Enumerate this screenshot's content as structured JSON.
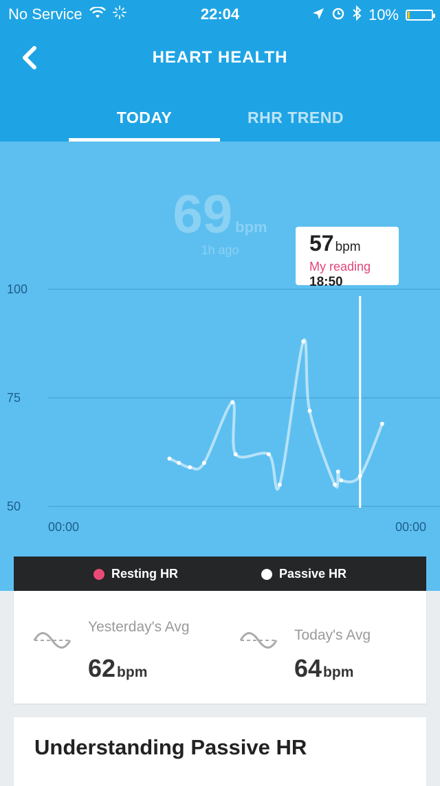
{
  "status": {
    "carrier": "No Service",
    "time": "22:04",
    "battery": "10%",
    "battery_level": 0.1
  },
  "header": {
    "title": "HEART HEALTH",
    "back_icon": "chevron-left-icon",
    "tabs": [
      {
        "label": "TODAY",
        "active": true
      },
      {
        "label": "RHR TREND",
        "active": false
      }
    ]
  },
  "current": {
    "value": "69",
    "unit": "bpm",
    "ago": "1h ago"
  },
  "tooltip": {
    "value": "57",
    "unit": "bpm",
    "label": "My reading",
    "time": "18:50"
  },
  "chart_data": {
    "type": "line",
    "ylim": [
      50,
      100
    ],
    "y_ticks": [
      "100",
      "75",
      "50"
    ],
    "x_ticks": [
      "00:00",
      "00:00"
    ],
    "x_hours": [
      0,
      24
    ],
    "series": [
      {
        "name": "Passive HR",
        "x": [
          7.7,
          8.3,
          9.0,
          9.9,
          11.7,
          11.9,
          14.0,
          14.7,
          16.2,
          16.6,
          18.2,
          18.4,
          18.6,
          19.8,
          21.2
        ],
        "values": [
          61,
          60,
          59,
          60,
          74,
          62,
          62,
          55,
          88,
          72,
          55,
          58,
          56,
          57,
          69
        ]
      }
    ],
    "highlight_x": 19.8,
    "grid": true
  },
  "legend": [
    {
      "label": "Resting HR",
      "color": "#ec4a76"
    },
    {
      "label": "Passive HR",
      "color": "#ffffff"
    }
  ],
  "averages": [
    {
      "label": "Yesterday's Avg",
      "value": "62",
      "unit": "bpm",
      "icon": "heart-wave-icon"
    },
    {
      "label": "Today's Avg",
      "value": "64",
      "unit": "bpm",
      "icon": "heart-wave-icon"
    }
  ],
  "info": {
    "heading": "Understanding Passive HR"
  }
}
